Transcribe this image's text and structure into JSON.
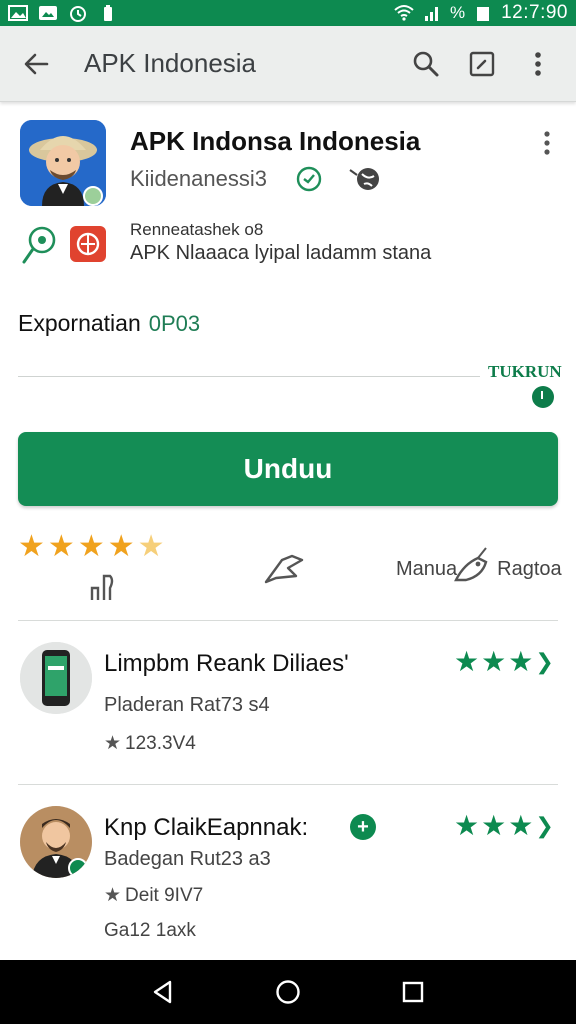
{
  "status_bar": {
    "time": "12:7:90",
    "battery_text": "%",
    "icons": [
      "image-icon",
      "photo-icon",
      "alarm-icon",
      "battery-small-icon",
      "wifi-icon",
      "signal-icon",
      "battery-icon"
    ]
  },
  "app_bar": {
    "title": "APK Indonesia",
    "icons": [
      "back-arrow-icon",
      "search-icon",
      "edit-icon",
      "more-vert-icon"
    ]
  },
  "app": {
    "title": "APK Indonsa Indonesia",
    "developer": "Kiidenanessi3",
    "info_line1": "Renneatashek o8",
    "info_line2": "APK Nlaaaca lyipal ladamm stana"
  },
  "exploration": {
    "label": "Expornatian",
    "code": "0P03",
    "tag": "TUKRUN"
  },
  "install": {
    "label": "Unduu"
  },
  "stats": {
    "rating_stars": 4.5,
    "right_label_a": "Manua",
    "right_label_b": "Ragtoa"
  },
  "reviews": [
    {
      "title": "Limpbm Reank Diliaes'",
      "subtitle": "Pladeran Rat73 s4",
      "meta": "123.3V4",
      "stars": 3,
      "avatar": "phone-avatar"
    },
    {
      "title": "Knp ClaikEapnnak:",
      "subtitle": "Badegan Rut23 a3",
      "meta": "Deit 9IV7",
      "extra": "Ga12 1aхk",
      "stars": 3,
      "avatar": "person-avatar"
    }
  ],
  "nav_bar": {
    "icons": [
      "nav-back-icon",
      "nav-home-icon",
      "nav-recent-icon"
    ]
  },
  "colors": {
    "status_bar": "#0d8a50",
    "install_button": "#148d55",
    "star_orange": "#f0a21e",
    "star_green": "#0d8a50"
  }
}
